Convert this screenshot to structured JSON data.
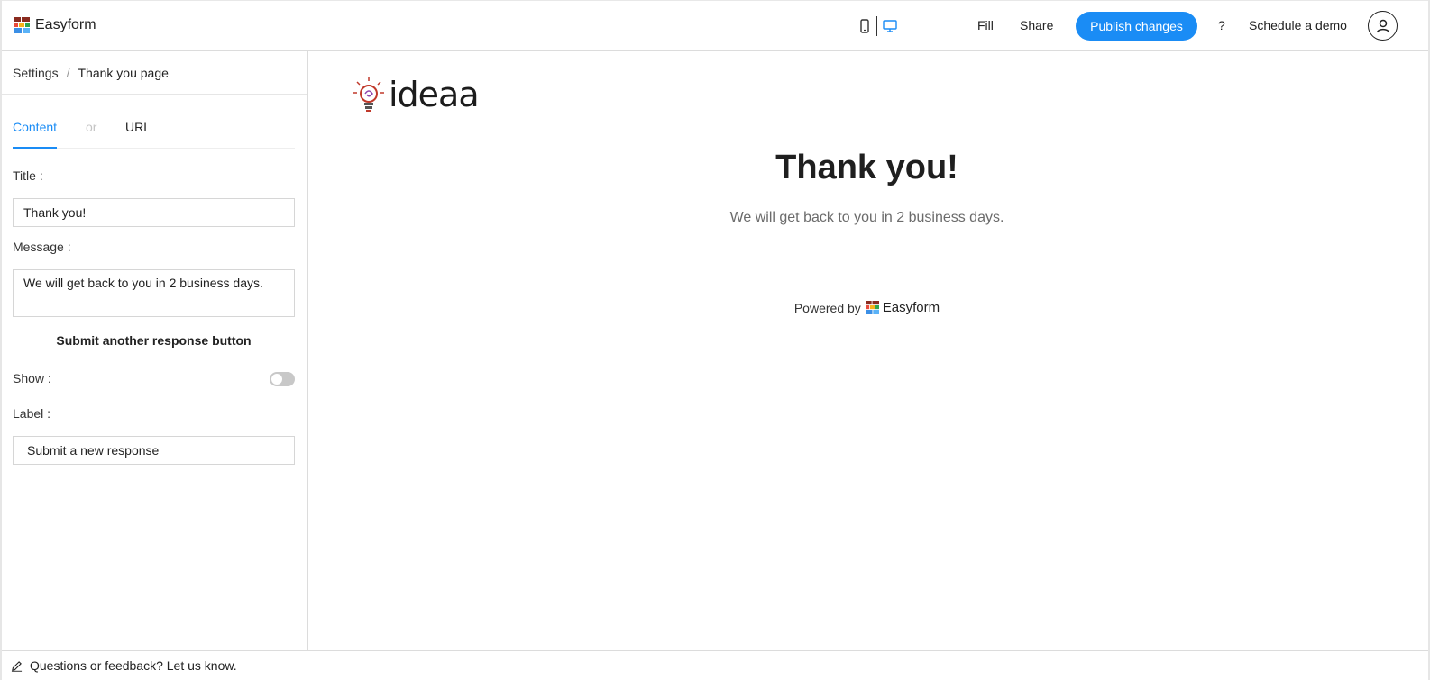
{
  "header": {
    "brand_name": "Easyform",
    "nav": {
      "fill": "Fill",
      "share": "Share",
      "publish": "Publish changes",
      "help": "?",
      "schedule_demo": "Schedule a demo"
    },
    "active_device": "desktop",
    "accent_color": "#1a8cf5"
  },
  "sidebar": {
    "breadcrumb": {
      "parent": "Settings",
      "separator": "/",
      "current": "Thank you page"
    },
    "tabs": {
      "content": "Content",
      "or": "or",
      "url": "URL",
      "active": "Content"
    },
    "title_label": "Title :",
    "title_value": "Thank you!",
    "message_label": "Message :",
    "message_value": "We will get back to you in 2 business days.",
    "section_heading": "Submit another response button",
    "show_label": "Show :",
    "show_enabled": false,
    "label_label": "Label :",
    "label_value": "Submit a new response"
  },
  "preview": {
    "logo_text": "ideaa",
    "title": "Thank you!",
    "message": "We will get back to you in 2 business days.",
    "powered_by": "Powered by",
    "powered_brand": "Easyform"
  },
  "footer": {
    "feedback": "Questions or feedback? Let us know."
  }
}
